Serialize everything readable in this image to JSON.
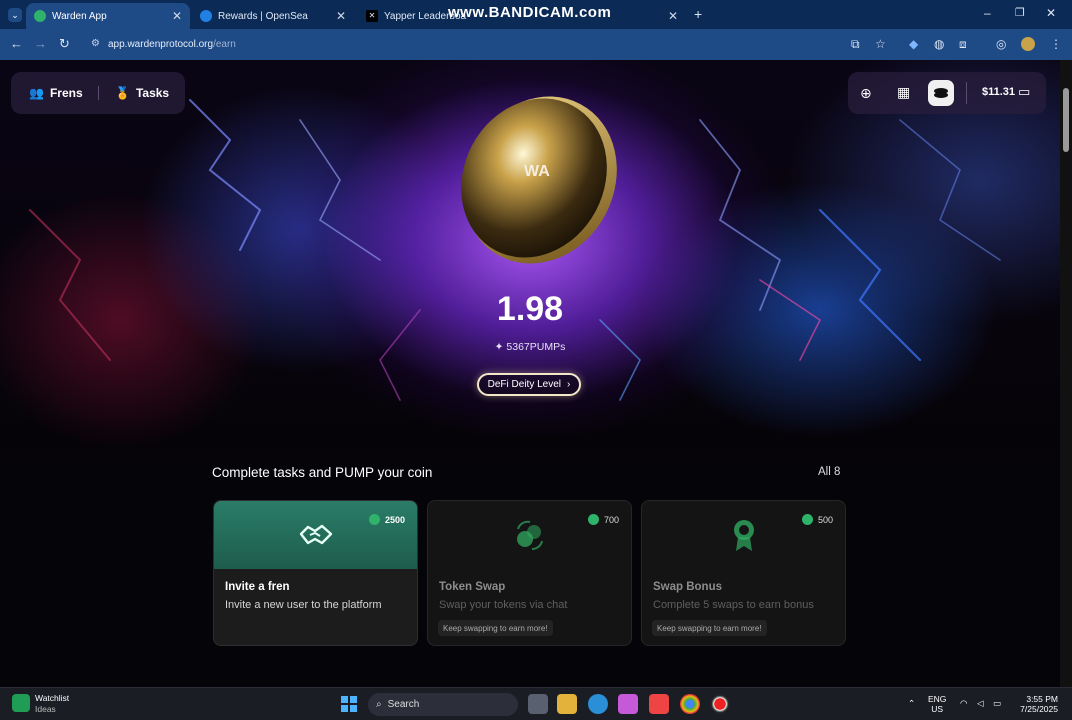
{
  "browser": {
    "tabs": [
      {
        "label": "Warden App",
        "active": true
      },
      {
        "label": "Rewards | OpenSea",
        "active": false
      },
      {
        "label": "Yapper Leaderboa",
        "active": false
      }
    ],
    "url_host": "app.wardenprotocol.org",
    "url_path": "/earn",
    "watermark": "www.BANDICAM.com"
  },
  "nav": {
    "frens_label": "Frens",
    "tasks_label": "Tasks",
    "wallet_balance": "$11.31"
  },
  "coin": {
    "logo_text": "WA",
    "balance": "1.98",
    "pumps": "5367PUMPs",
    "level_label": "DeFi Deity Level",
    "level_chevron": "›"
  },
  "tasks": {
    "section_title": "Complete tasks and PUMP your coin",
    "all_link": "All 8",
    "cards": [
      {
        "points": "2500",
        "title": "Invite a fren",
        "desc": "Invite a new user to the platform",
        "hint": ""
      },
      {
        "points": "700",
        "title": "Token Swap",
        "desc": "Swap your tokens via chat",
        "hint": "Keep swapping to earn more!"
      },
      {
        "points": "500",
        "title": "Swap Bonus",
        "desc": "Complete 5 swaps to earn bonus",
        "hint": "Keep swapping to earn more!"
      }
    ]
  },
  "taskbar": {
    "widget_title": "Watchlist",
    "widget_sub": "Ideas",
    "search_label": "Search",
    "lang_1": "ENG",
    "lang_2": "US",
    "time": "3:55 PM",
    "date": "7/25/2025"
  },
  "colors": {
    "accent_green": "#2fb36a",
    "card_active_top": "#2a7d68",
    "browser_tabbar": "#0b2a55",
    "browser_toolbar": "#1e4a86"
  }
}
